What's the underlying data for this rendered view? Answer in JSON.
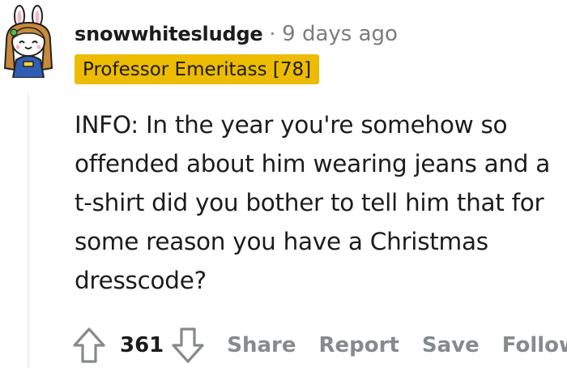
{
  "comment": {
    "username": "snowwhitesludge",
    "separator": "·",
    "timestamp": "9 days ago",
    "flair": "Professor Emeritass [78]",
    "body": "INFO: In the year you're somehow so offended about him wearing jeans and a t-shirt did you bother to tell him that for some reason you have a Christmas dresscode?",
    "score": "361"
  },
  "actions": {
    "share": "Share",
    "report": "Report",
    "save": "Save",
    "follow": "Follow"
  },
  "icons": {
    "avatar": "snoo-bunny-avatar",
    "upvote": "arrow-up-icon",
    "downvote": "arrow-down-icon"
  },
  "colors": {
    "flair_background": "#edbb00",
    "muted_text": "#878a8c",
    "timestamp": "#7c7c7c"
  }
}
